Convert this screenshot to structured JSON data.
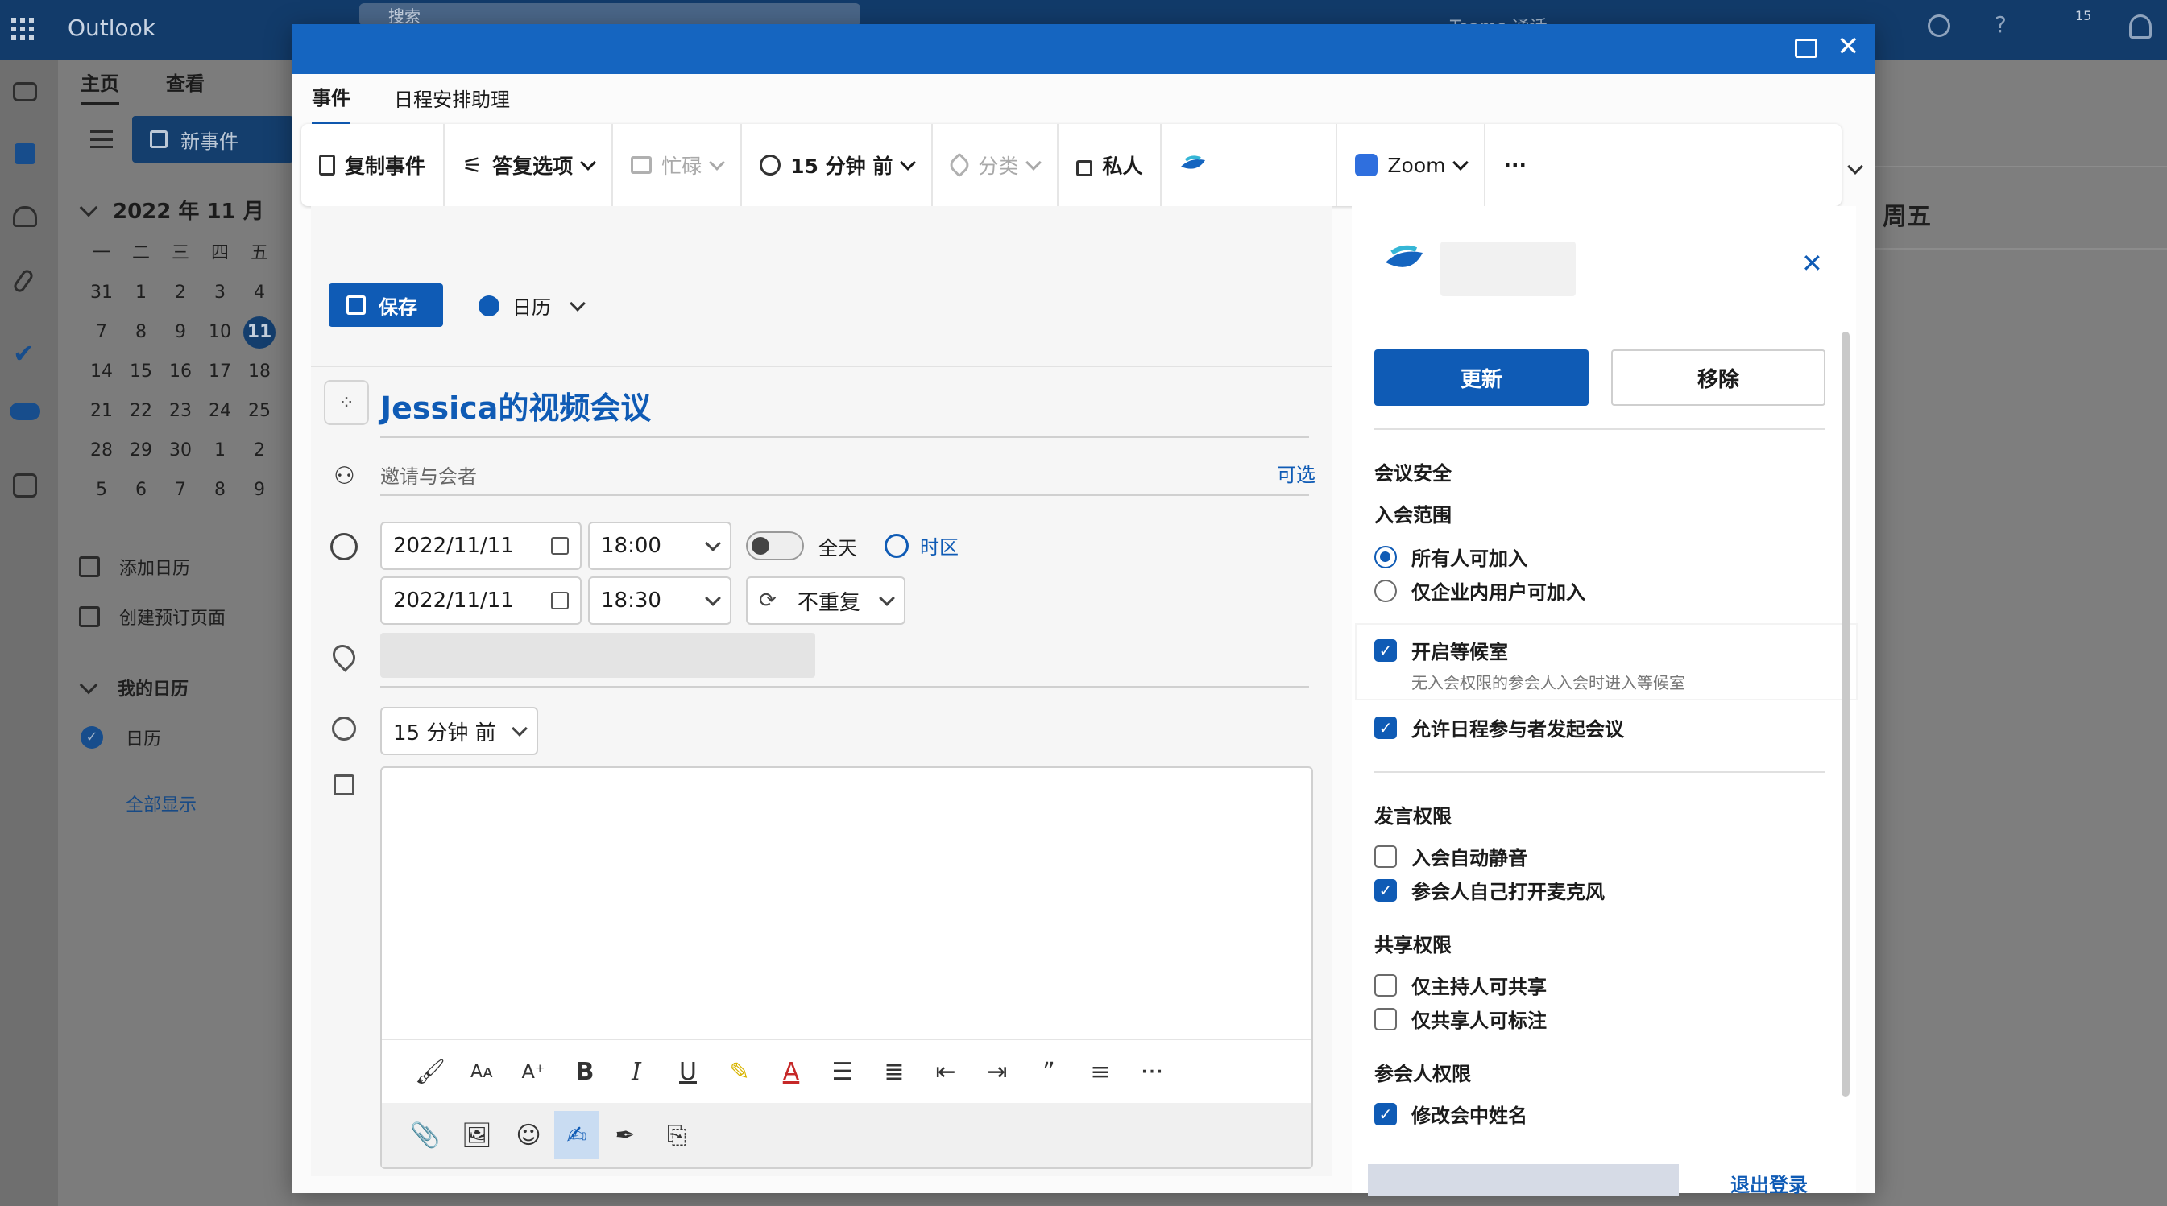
{
  "app": {
    "name": "Outlook",
    "search_placeholder": "搜索",
    "teams_label": "Teams 通话",
    "notif_count": "15"
  },
  "ribbon": {
    "tabs": [
      "主页",
      "查看"
    ],
    "new_event": "新事件"
  },
  "calendar": {
    "month": "2022 年 11 月",
    "weekdays": [
      "一",
      "二",
      "三",
      "四",
      "五"
    ],
    "weeks": [
      [
        "31",
        "1",
        "2",
        "3",
        "4"
      ],
      [
        "7",
        "8",
        "9",
        "10",
        "11"
      ],
      [
        "14",
        "15",
        "16",
        "17",
        "18"
      ],
      [
        "21",
        "22",
        "23",
        "24",
        "25"
      ],
      [
        "28",
        "29",
        "30",
        "1",
        "2"
      ],
      [
        "5",
        "6",
        "7",
        "8",
        "9"
      ]
    ],
    "today": "11",
    "add_calendar": "添加日历",
    "create_booking": "创建预订页面",
    "my_calendars": "我的日历",
    "calendar_item": "日历",
    "show_all": "全部显示"
  },
  "right_bg": {
    "day_header": "周五"
  },
  "dialog": {
    "tabs": [
      "事件",
      "日程安排助理"
    ],
    "toolbar": {
      "copy": "复制事件",
      "reply": "答复选项",
      "busy": "忙碌",
      "reminder": "15 分钟 前",
      "category": "分类",
      "private": "私人",
      "zoom": "Zoom",
      "more": "···"
    },
    "save": "保存",
    "calendar_select": "日历",
    "title": "Jessica的视频会议",
    "attendees_placeholder": "邀请与会者",
    "optional": "可选",
    "start_date": "2022/11/11",
    "start_time": "18:00",
    "allday": "全天",
    "timezone": "时区",
    "end_date": "2022/11/11",
    "end_time": "18:30",
    "repeat": "不重复",
    "reminder": "15 分钟 前"
  },
  "panel": {
    "update": "更新",
    "remove": "移除",
    "security_title": "会议安全",
    "scope_title": "入会范围",
    "scope_options": [
      {
        "label": "所有人可加入",
        "selected": true
      },
      {
        "label": "仅企业内用户可加入",
        "selected": false
      }
    ],
    "waiting_room": {
      "label": "开启等候室",
      "desc": "无入会权限的参会人入会时进入等候室",
      "checked": true
    },
    "allow_attendees": {
      "label": "允许日程参与者发起会议",
      "checked": true
    },
    "speak_title": "发言权限",
    "mute_on_join": {
      "label": "入会自动静音",
      "checked": false
    },
    "self_unmute": {
      "label": "参会人自己打开麦克风",
      "checked": true
    },
    "share_title": "共享权限",
    "host_share": {
      "label": "仅主持人可共享",
      "checked": false
    },
    "sharer_annotate": {
      "label": "仅共享人可标注",
      "checked": false
    },
    "participant_title": "参会人权限",
    "rename": {
      "label": "修改会中姓名",
      "checked": true
    },
    "logout": "退出登录"
  },
  "colors": {
    "accent": "#0f5bb5",
    "titlebar": "#1565c0",
    "topbar": "#123b6a"
  }
}
